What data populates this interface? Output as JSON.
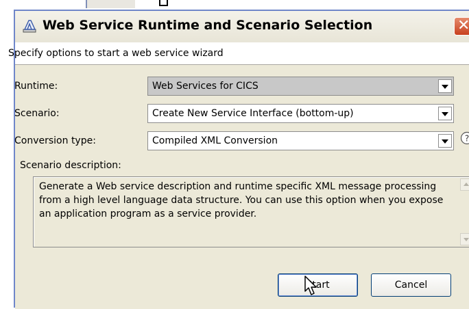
{
  "window": {
    "title": "Web Service Runtime and Scenario Selection"
  },
  "header": {
    "text": "Specify options to start a web service wizard"
  },
  "form": {
    "runtime": {
      "label": "Runtime:",
      "value": "Web Services for CICS"
    },
    "scenario": {
      "label": "Scenario:",
      "value": "Create New Service Interface (bottom-up)"
    },
    "conversion": {
      "label": "Conversion type:",
      "value": "Compiled XML Conversion"
    },
    "description_label": "Scenario description:",
    "description": "Generate a Web service description and runtime specific XML message processing from a high level language data structure.  You can use this option when you expose an application program as a service provider."
  },
  "buttons": {
    "start": "Start",
    "cancel": "Cancel"
  },
  "colors": {
    "title_border": "#6f86c9",
    "close": "#c8401f",
    "dialog_bg": "#ece9d8"
  },
  "icons": [
    "wizard-icon",
    "close-icon",
    "help-icon",
    "chevron-down-icon",
    "mouse-cursor-icon"
  ]
}
